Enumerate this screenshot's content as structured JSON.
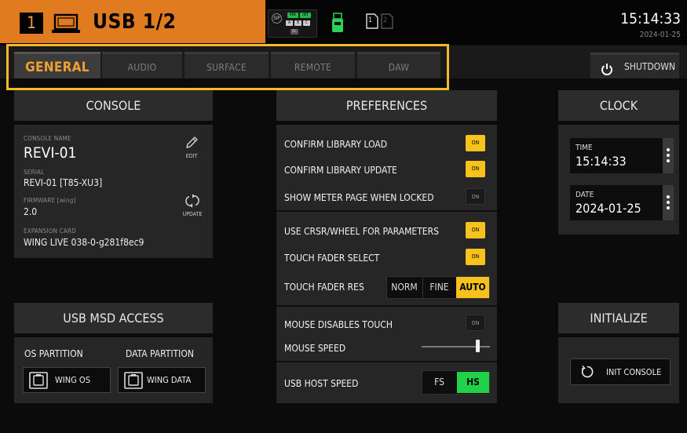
{
  "header": {
    "channel_number": "1",
    "title": "USB 1/2",
    "sip_label": "SIP",
    "sample_rate": "48K",
    "int_label": "INT",
    "abc_a": "A",
    "abc_b": "B",
    "abc_c": "C",
    "sc_label": "SC",
    "card1": "1",
    "card2": "2",
    "time": "15:14:33",
    "date": "2024-01-25"
  },
  "tabs": [
    {
      "label": "GENERAL",
      "active": true
    },
    {
      "label": "AUDIO"
    },
    {
      "label": "SURFACE"
    },
    {
      "label": "REMOTE"
    },
    {
      "label": "DAW"
    }
  ],
  "shutdown_label": "SHUTDOWN",
  "console": {
    "header": "CONSOLE",
    "name_label": "CONSOLE NAME",
    "name": "REVI-01",
    "edit_label": "EDIT",
    "serial_label": "SERIAL",
    "serial": "REVI-01 [T85-XU3]",
    "firmware_label": "FIRMWARE [wing]",
    "firmware": "2.0",
    "update_label": "UPDATE",
    "expansion_label": "EXPANSION CARD",
    "expansion": "WING LIVE  038-0-g281f8ec9"
  },
  "usb_msd": {
    "header": "USB MSD ACCESS",
    "os_partition_label": "OS PARTITION",
    "data_partition_label": "DATA PARTITION",
    "os_button": "WING OS",
    "data_button": "WING DATA"
  },
  "preferences": {
    "header": "PREFERENCES",
    "confirm_library_load": {
      "label": "CONFIRM LIBRARY LOAD",
      "toggle": "ON",
      "state": true
    },
    "confirm_library_update": {
      "label": "CONFIRM LIBRARY UPDATE",
      "toggle": "ON",
      "state": true
    },
    "show_meter_page": {
      "label": "SHOW METER PAGE WHEN LOCKED",
      "toggle": "ON",
      "state": false
    },
    "use_crsr_wheel": {
      "label": "USE CRSR/WHEEL FOR PARAMETERS",
      "toggle": "ON",
      "state": true
    },
    "touch_fader_select": {
      "label": "TOUCH FADER SELECT",
      "toggle": "ON",
      "state": true
    },
    "touch_fader_res": {
      "label": "TOUCH FADER RES",
      "options": [
        "NORM",
        "FINE",
        "AUTO"
      ],
      "selected": "AUTO"
    },
    "mouse_disables_touch": {
      "label": "MOUSE DISABLES TOUCH",
      "toggle": "ON",
      "state": false
    },
    "mouse_speed": {
      "label": "MOUSE SPEED",
      "level_fraction": 0.82
    },
    "usb_host_speed": {
      "label": "USB HOST SPEED",
      "options": [
        "FS",
        "HS"
      ],
      "selected": "HS"
    }
  },
  "clock": {
    "header": "CLOCK",
    "time_label": "TIME",
    "time": "15:14:33",
    "date_label": "DATE",
    "date": "2024-01-25"
  },
  "initialize": {
    "header": "INITIALIZE",
    "button": "INIT CONSOLE"
  },
  "colors": {
    "accent_orange": "#e07b20",
    "highlight_yellow": "#f4b82a",
    "on_yellow": "#f7c21b",
    "hs_green": "#1fd24a"
  }
}
